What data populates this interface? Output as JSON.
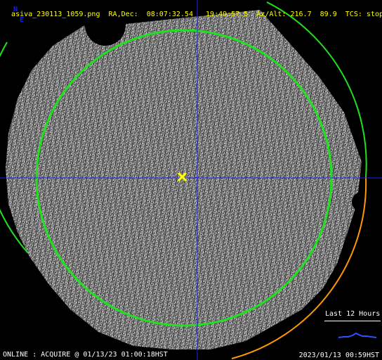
{
  "header": {
    "filename": "asiva_230113_1059.png",
    "radec_label": "RA,Dec:",
    "ra": "08:07:32.54",
    "dec": "19:49:57.5",
    "azalt_label": "Az/Alt:",
    "az": "216.7",
    "alt": "89.9",
    "tcs_label": "TCS:",
    "tcs_value": "stop"
  },
  "compass": {
    "north": "N",
    "east": "E"
  },
  "status": {
    "text": "ONLINE : ACQUIRE @ 01/13/23 01:00:18HST"
  },
  "timestamp": "2023/01/13 00:59HST",
  "trend": {
    "label": "Last 12 Hours"
  },
  "colors": {
    "crosshair": "#2020ff",
    "field_circle": "#20e020",
    "horizon_arc": "#20e020",
    "horizon_arc_warning": "#ff9900",
    "marker": "#ffff00",
    "trend_line": "#3050ff"
  },
  "icons": {
    "target": "x-marker-icon"
  }
}
